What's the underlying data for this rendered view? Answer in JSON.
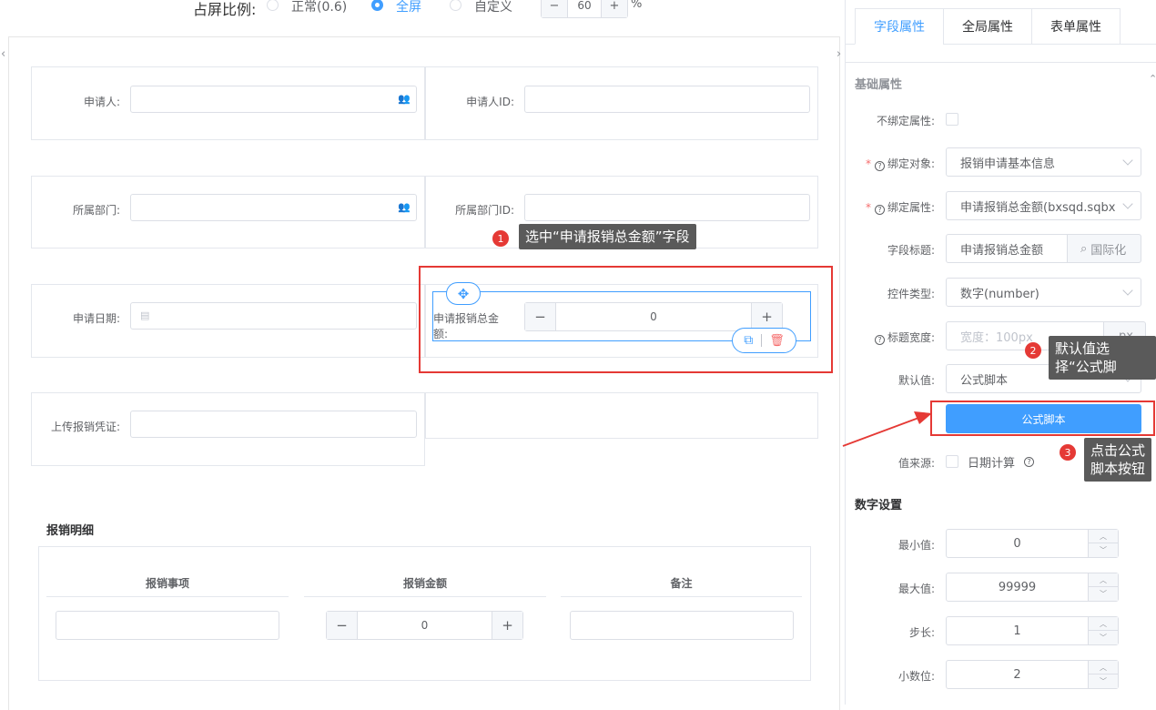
{
  "ratio": {
    "label": "占屏比例:",
    "options": [
      "正常(0.6)",
      "全屏",
      "自定义"
    ],
    "selected": "全屏",
    "custom_value": "60",
    "custom_minus": "−",
    "custom_plus": "+",
    "unit": "%"
  },
  "form": {
    "applicant_label": "申请人:",
    "applicant_id_label": "申请人ID:",
    "department_label": "所属部门:",
    "department_id_label": "所属部门ID:",
    "apply_date_label": "申请日期:",
    "total_amount_label": "申请报销总金额:",
    "total_amount_value": "0",
    "upload_label": "上传报销凭证:",
    "stepper_minus": "−",
    "stepper_plus": "+"
  },
  "detail_table": {
    "title": "报销明细",
    "columns": [
      "报销事项",
      "报销金额",
      "备注"
    ],
    "amount_value": "0"
  },
  "panel": {
    "tabs": [
      "字段属性",
      "全局属性",
      "表单属性"
    ],
    "active_tab": "字段属性",
    "basic_section": "基础属性",
    "unbind_label": "不绑定属性:",
    "bind_object_label": "绑定对象:",
    "bind_object_value": "报销申请基本信息",
    "bind_field_label": "绑定属性:",
    "bind_field_value": "申请报销总金额(bxsqd.sqbxzje)",
    "field_title_label": "字段标题:",
    "field_title_value": "申请报销总金额",
    "i18n_button": "国际化",
    "control_type_label": "控件类型:",
    "control_type_value": "数字(number)",
    "title_width_label": "标题宽度:",
    "title_width_placeholder": "宽度：100px",
    "title_width_unit": "px",
    "default_label": "默认值:",
    "default_value": "公式脚本",
    "formula_button": "公式脚本",
    "value_source_label": "值来源:",
    "date_calc_label": "日期计算",
    "number_section": "数字设置",
    "min_label": "最小值:",
    "min_value": "0",
    "max_label": "最大值:",
    "max_value": "99999",
    "step_label": "步长:",
    "step_value": "1",
    "decimal_label": "小数位:",
    "decimal_value": "2"
  },
  "annotations": {
    "step1_num": "1",
    "step1_text": "选中“申请报销总金额”字段",
    "step2_num": "2",
    "step2_line1": "默认值选",
    "step2_line2": "择“公式脚",
    "step3_num": "3",
    "step3_line1": "点击公式",
    "step3_line2": "脚本按钮"
  },
  "colors": {
    "accent": "#409eff",
    "annotation_red": "#e53935",
    "callout_bg": "#5a5a5a"
  }
}
